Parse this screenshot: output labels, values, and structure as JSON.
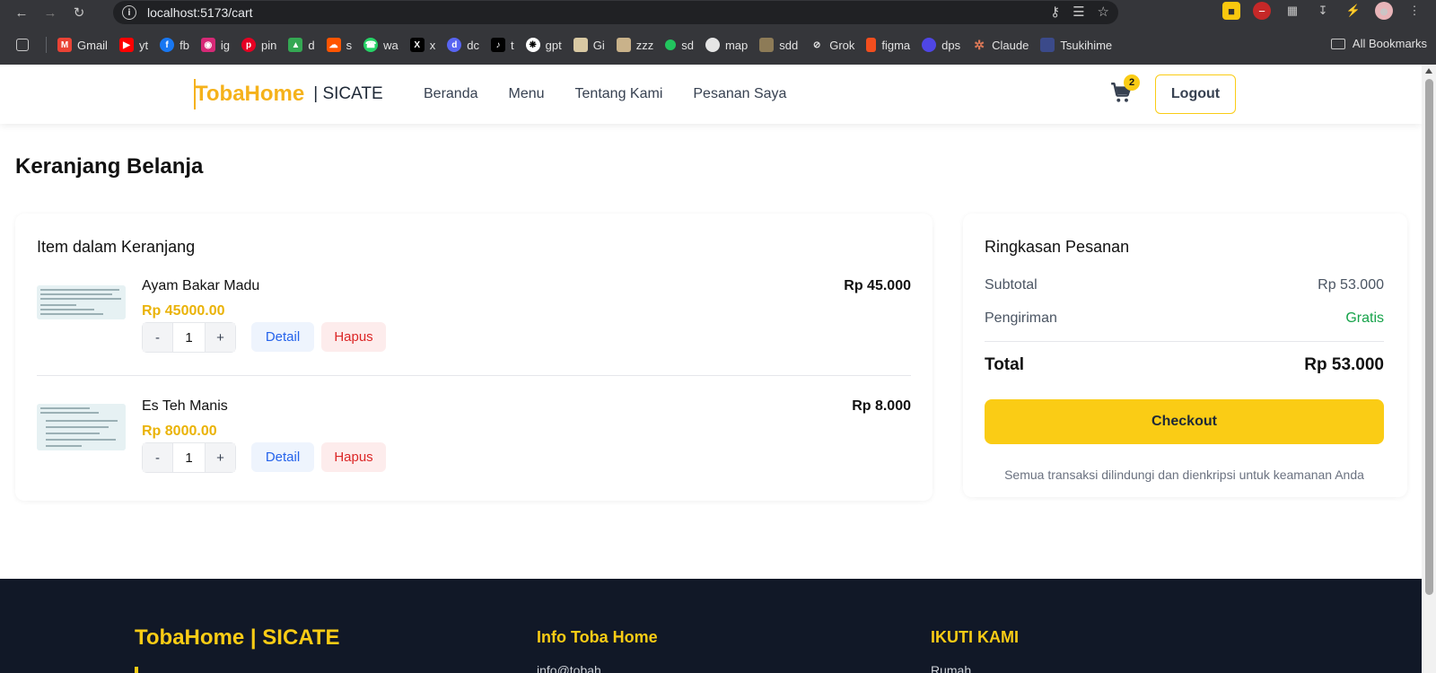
{
  "browser": {
    "url": "localhost:5173/cart",
    "bookmarks": [
      "Gmail",
      "yt",
      "fb",
      "ig",
      "pin",
      "d",
      "s",
      "wa",
      "x",
      "dc",
      "t",
      "gpt",
      "Gi",
      "zzz",
      "sd",
      "map",
      "sdd",
      "Grok",
      "figma",
      "dps",
      "Claude",
      "Tsukihime"
    ],
    "all_bookmarks": "All Bookmarks"
  },
  "header": {
    "logo": "TobaHome",
    "logo_sub": "| SICATE",
    "nav": [
      "Beranda",
      "Menu",
      "Tentang Kami",
      "Pesanan Saya"
    ],
    "cart_count": "2",
    "logout": "Logout"
  },
  "page": {
    "title": "Keranjang Belanja"
  },
  "cart": {
    "title": "Item dalam Keranjang",
    "items": [
      {
        "name": "Ayam Bakar Madu",
        "price": "Rp 45000.00",
        "total": "Rp 45.000",
        "qty": "1",
        "minus": "-",
        "plus": "+",
        "detail": "Detail",
        "remove": "Hapus"
      },
      {
        "name": "Es Teh Manis",
        "price": "Rp 8000.00",
        "total": "Rp 8.000",
        "qty": "1",
        "minus": "-",
        "plus": "+",
        "detail": "Detail",
        "remove": "Hapus"
      }
    ]
  },
  "summary": {
    "title": "Ringkasan Pesanan",
    "subtotal_label": "Subtotal",
    "subtotal_value": "Rp 53.000",
    "shipping_label": "Pengiriman",
    "shipping_value": "Gratis",
    "total_label": "Total",
    "total_value": "Rp 53.000",
    "checkout": "Checkout",
    "secure_note": "Semua transaksi dilindungi dan dienkripsi untuk keamanan Anda"
  },
  "footer": {
    "brand": "TobaHome | SICATE",
    "info_heading": "Info Toba Home",
    "info_line": "info@tobah...",
    "follow_heading": "IKUTI KAMI",
    "follow_line": "Rumah..."
  },
  "colors": {
    "accent": "#facc15",
    "logo": "#f5b21b",
    "shipping_free": "#16a34a",
    "footer_bg": "#111827"
  }
}
